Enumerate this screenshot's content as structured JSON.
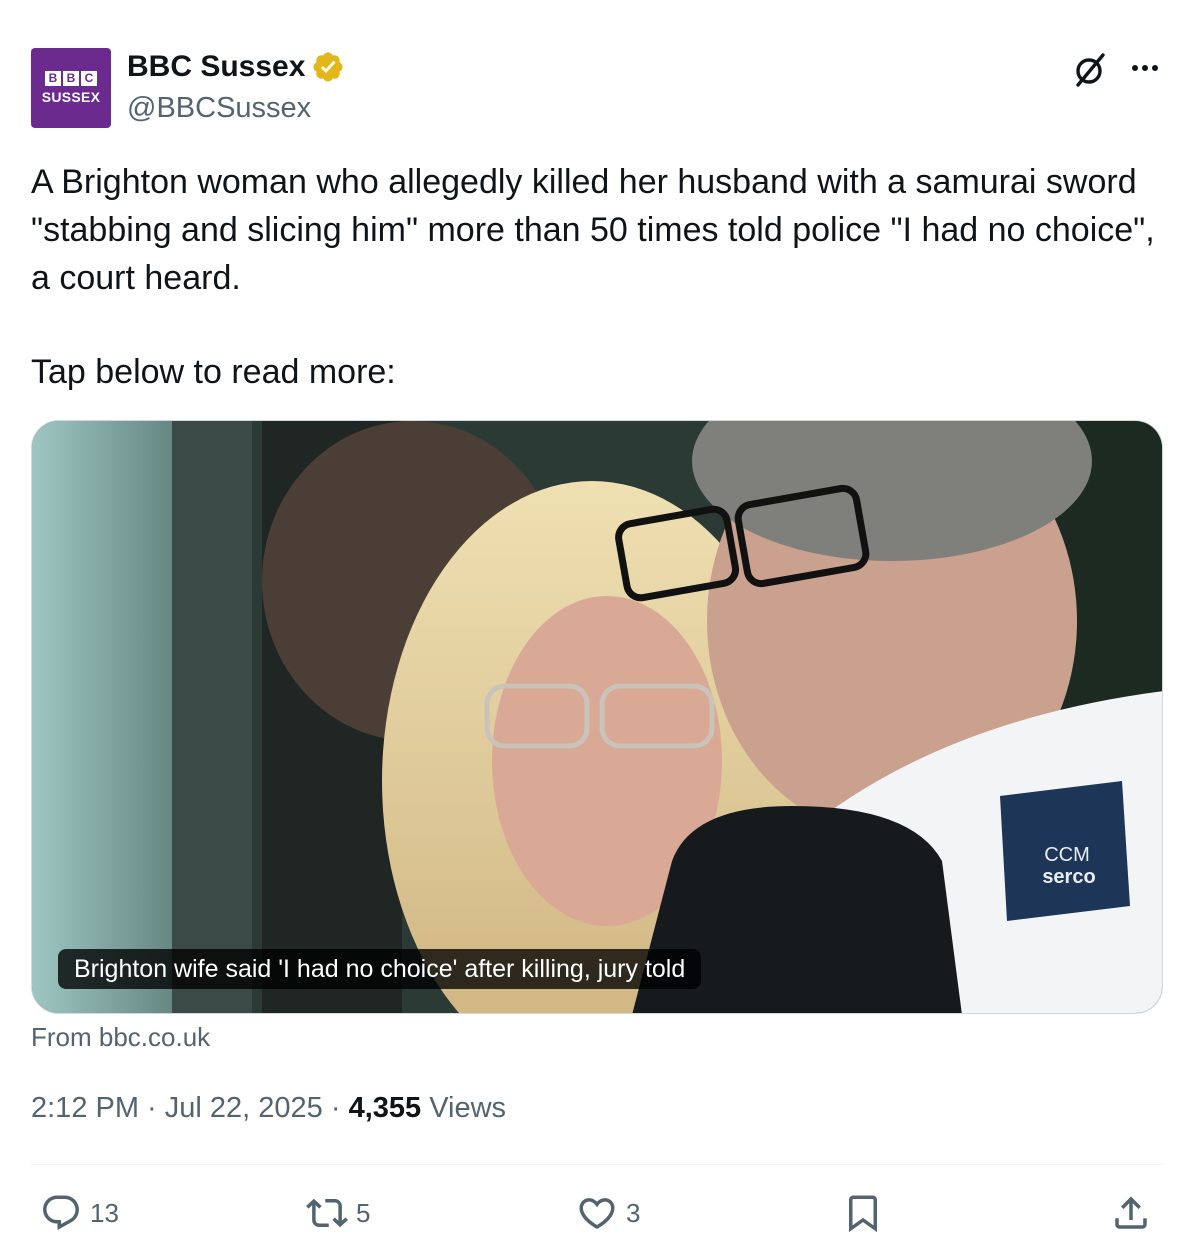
{
  "author": {
    "avatar_top": "BBC",
    "avatar_label": "SUSSEX",
    "display_name": "BBC Sussex",
    "handle": "@BBCSussex",
    "verified_icon": "verified-badge-gold"
  },
  "header_icons": {
    "grok": "grok-icon",
    "more": "more-icon"
  },
  "tweet": {
    "text": "A Brighton woman who allegedly killed her husband with a samurai sword \"stabbing and slicing him\" more than 50 times told police \"I had no choice\", a court heard.",
    "text2": "Tap below to read more:"
  },
  "card": {
    "headline": "Brighton wife said 'I had no choice' after killing, jury told",
    "source": "From bbc.co.uk",
    "badge_line1": "CCM",
    "badge_line2": "serco"
  },
  "meta": {
    "time": "2:12 PM",
    "separator1": " · ",
    "date": "Jul 22, 2025",
    "separator2": " · ",
    "views_count": "4,355",
    "views_label": " Views"
  },
  "actions": {
    "replies": "13",
    "reposts": "5",
    "likes": "3"
  },
  "colors": {
    "text_primary": "#0f1419",
    "text_secondary": "#536471",
    "avatar_bg": "#6b2a8e",
    "verified_gold": "#e2b719"
  }
}
